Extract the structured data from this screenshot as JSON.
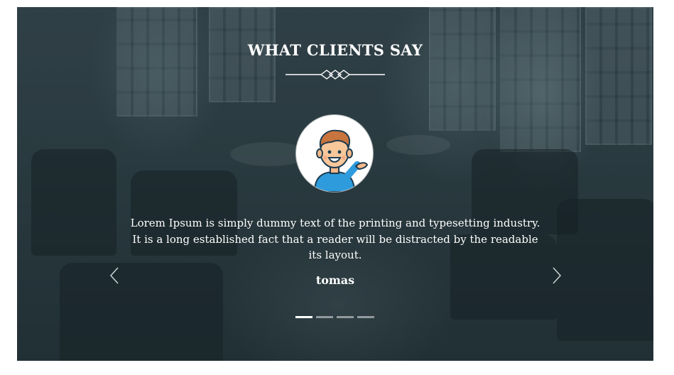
{
  "section": {
    "title": "WHAT CLIENTS SAY"
  },
  "testimonial": {
    "quote": "Lorem Ipsum is simply dummy text of the printing and typesetting industry. It is a long established fact that a reader will be distracted by the readable its layout.",
    "author": "tomas",
    "avatar_icon": "waving-man-avatar-icon"
  },
  "slider": {
    "slide_count": 4,
    "active_index": 0,
    "prev_icon": "chevron-left-icon",
    "next_icon": "chevron-right-icon"
  },
  "colors": {
    "text": "#ffffff",
    "overlay": "#2b3a40",
    "dot_inactive": "#c8cdcf",
    "dot_active": "#ffffff"
  }
}
